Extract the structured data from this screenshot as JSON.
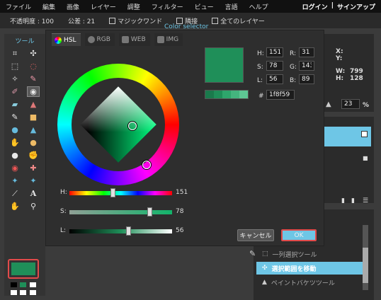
{
  "menu": {
    "items": [
      "ファイル",
      "編集",
      "画像",
      "レイヤー",
      "調整",
      "フィルター",
      "ビュー",
      "言語",
      "ヘルプ"
    ],
    "login": "ログイン",
    "separator": "|",
    "signup": "サインアップ"
  },
  "options": {
    "opacity": "不透明度 : 100",
    "tolerance": "公差 : 21",
    "magic_wand": "マジックワンド",
    "contiguous": "隣接",
    "all_layers": "全てのレイヤー"
  },
  "toolbox": {
    "title": "ツール",
    "foreground_color": "#1f8f59",
    "tools": [
      "crop-icon",
      "move-icon",
      "marquee-icon",
      "lasso-icon",
      "magic-wand-icon",
      "pencil-icon",
      "brush-icon",
      "color-picker-icon",
      "eraser-icon",
      "paint-bucket-icon",
      "gradient-icon",
      "stamp-icon",
      "bloat-icon",
      "sharpen-icon",
      "drop-icon",
      "triangle-icon",
      "smudge-icon",
      "sponge-icon",
      "burn-icon",
      "dodge-icon",
      "red-eye-icon",
      "spot-heal-icon",
      "clone-icon",
      "pinch-icon",
      "line-icon",
      "text-icon",
      "hand-icon",
      "zoom-icon"
    ]
  },
  "navigator": {
    "x_label": "X:",
    "y_label": "Y:",
    "w_label": "W:",
    "w_value": "799",
    "h_label": "H:",
    "h_value": "128",
    "zoom": "23",
    "zoom_unit": "%"
  },
  "dialog": {
    "title": "Color selector",
    "tabs": [
      "HSL",
      "RGB",
      "WEB",
      "IMG"
    ],
    "sliders": {
      "h_label": "H:",
      "h_value": "151",
      "s_label": "S:",
      "s_value": "78",
      "l_label": "L:",
      "l_value": "56"
    },
    "fields": {
      "h_label": "H:",
      "h": "151",
      "s_label": "S:",
      "s": "78",
      "l_label": "L:",
      "l": "56",
      "r_label": "R:",
      "r": "31",
      "g_label": "G:",
      "g": "143",
      "b_label": "B:",
      "b": "89",
      "hex_label": "#",
      "hex": "1f8f59"
    },
    "cancel_label": "キャンセル",
    "ok_label": "OK",
    "preview_color": "#1f8f59"
  },
  "history": {
    "items": [
      "一列選択ツール",
      "選択範囲を移動",
      "ペイントバケツツール"
    ]
  },
  "colors": {
    "accent": "#6ec6e6",
    "highlight_border": "#e24a4a"
  }
}
